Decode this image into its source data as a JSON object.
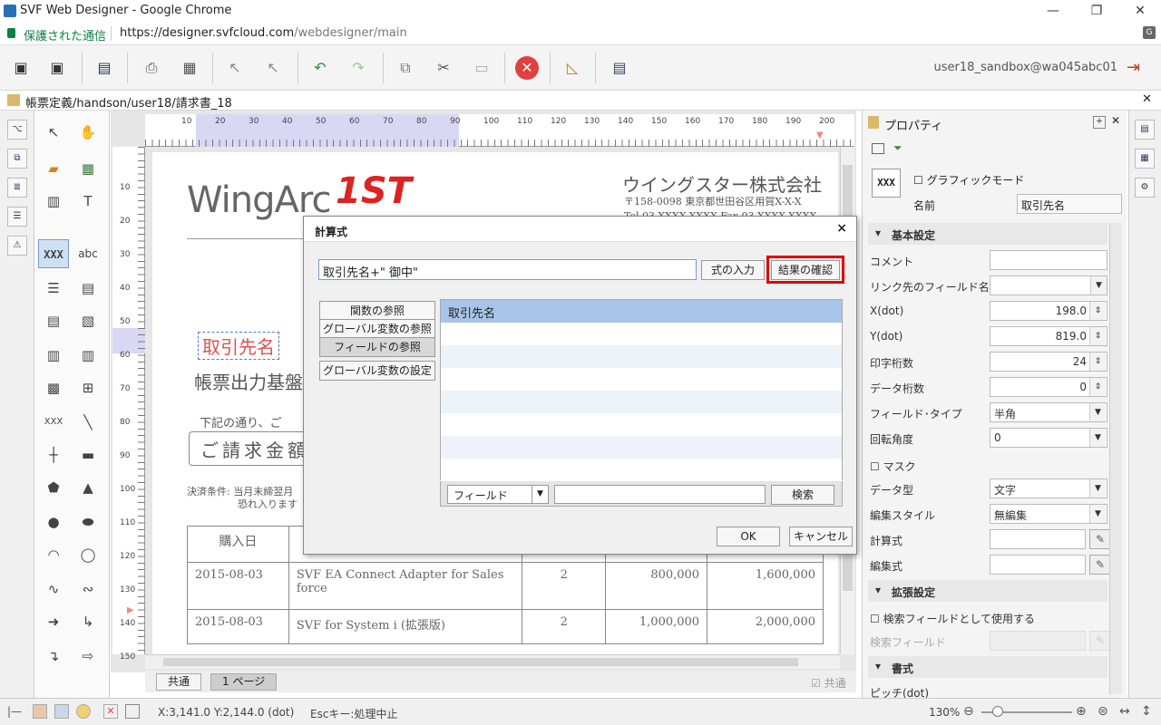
{
  "browser": {
    "title": "SVF Web Designer - Google Chrome",
    "secure_label": "保護された通信",
    "url_host": "https://designer.svfcloud.com",
    "url_path": "/webdesigner/main"
  },
  "toolbar": {
    "user": "user18_sandbox@wa045abc01"
  },
  "doc": {
    "path": "帳票定義/handson/user18/請求書_18"
  },
  "ruler": {
    "h_labels": [
      "10",
      "20",
      "30",
      "40",
      "50",
      "60",
      "70",
      "80",
      "90",
      "100",
      "110",
      "120",
      "130",
      "140",
      "150",
      "160",
      "170",
      "180",
      "190",
      "200"
    ],
    "v_labels": [
      "10",
      "20",
      "30",
      "40",
      "50",
      "60",
      "70",
      "80",
      "90",
      "100",
      "110",
      "120",
      "130",
      "140",
      "150"
    ]
  },
  "page": {
    "logo": "WingArc",
    "logo_mark": "1ST",
    "company": "ウイングスター株式会社",
    "address": "〒158-0098 東京都世田谷区用賀X-X-X",
    "tel": "Tel 03-XXXX-XXXX  Fax 03-XXXX-XXXX",
    "field_sample": "取引先名",
    "subtitle": "帳票出力基盤",
    "note": "下記の通り、ご",
    "amount_label": "ご請求金額",
    "terms1": "決済条件: 当月末締翌月",
    "terms2": "恐れ入ります",
    "table": {
      "header": [
        "購入日",
        "",
        "",
        "",
        ""
      ],
      "rows": [
        [
          "2015-08-03",
          "SVF EA Connect Adapter for Sales force",
          "2",
          "800,000",
          "1,600,000"
        ],
        [
          "2015-08-03",
          "SVF for System i (拡張版)",
          "2",
          "1,000,000",
          "2,000,000"
        ]
      ]
    }
  },
  "page_tabs": [
    "共通",
    "1 ページ"
  ],
  "page_tabs_right": "共通",
  "dialog": {
    "title": "計算式",
    "close": "×",
    "formula": "取引先名+\" 御中\"",
    "btn_input": "式の入力",
    "btn_confirm": "結果の確認",
    "side_buttons": [
      "関数の参照",
      "グローバル変数の参照",
      "フィールドの参照",
      "グローバル変数の設定"
    ],
    "list_items": [
      "取引先名",
      "",
      "",
      "",
      "",
      "",
      "",
      ""
    ],
    "filter_select": "フィールド",
    "search_button": "検索",
    "ok": "OK",
    "cancel": "キャンセル"
  },
  "props": {
    "title": "プロパティ",
    "graphic_mode": "グラフィックモード",
    "name_label": "名前",
    "name_value": "取引先名",
    "sec_basic": "基本設定",
    "comment": "コメント",
    "link_field": "リンク先のフィールド名",
    "x_label": "X(dot)",
    "x_value": "198.0",
    "y_label": "Y(dot)",
    "y_value": "819.0",
    "digits_label": "印字桁数",
    "digits_value": "24",
    "data_digits_label": "データ桁数",
    "data_digits_value": "0",
    "field_type_label": "フィールド･タイプ",
    "field_type_value": "半角",
    "rotation_label": "回転角度",
    "rotation_value": "0",
    "mask": "マスク",
    "data_type_label": "データ型",
    "data_type_value": "文字",
    "edit_style_label": "編集スタイル",
    "edit_style_value": "無編集",
    "calc_label": "計算式",
    "edit_formula_label": "編集式",
    "sec_ext": "拡張設定",
    "search_field_use": "検索フィールドとして使用する",
    "search_field": "検索フィールド",
    "sec_format": "書式",
    "pitch": "ピッチ(dot)"
  },
  "status": {
    "coords": "X:3,141.0 Y:2,144.0 (dot)",
    "hint": "Escキー:処理中止",
    "zoom": "130%"
  },
  "colors": {
    "highlight": "#e00000",
    "selection": "#a8c4e8",
    "accent_red": "#e04040"
  }
}
